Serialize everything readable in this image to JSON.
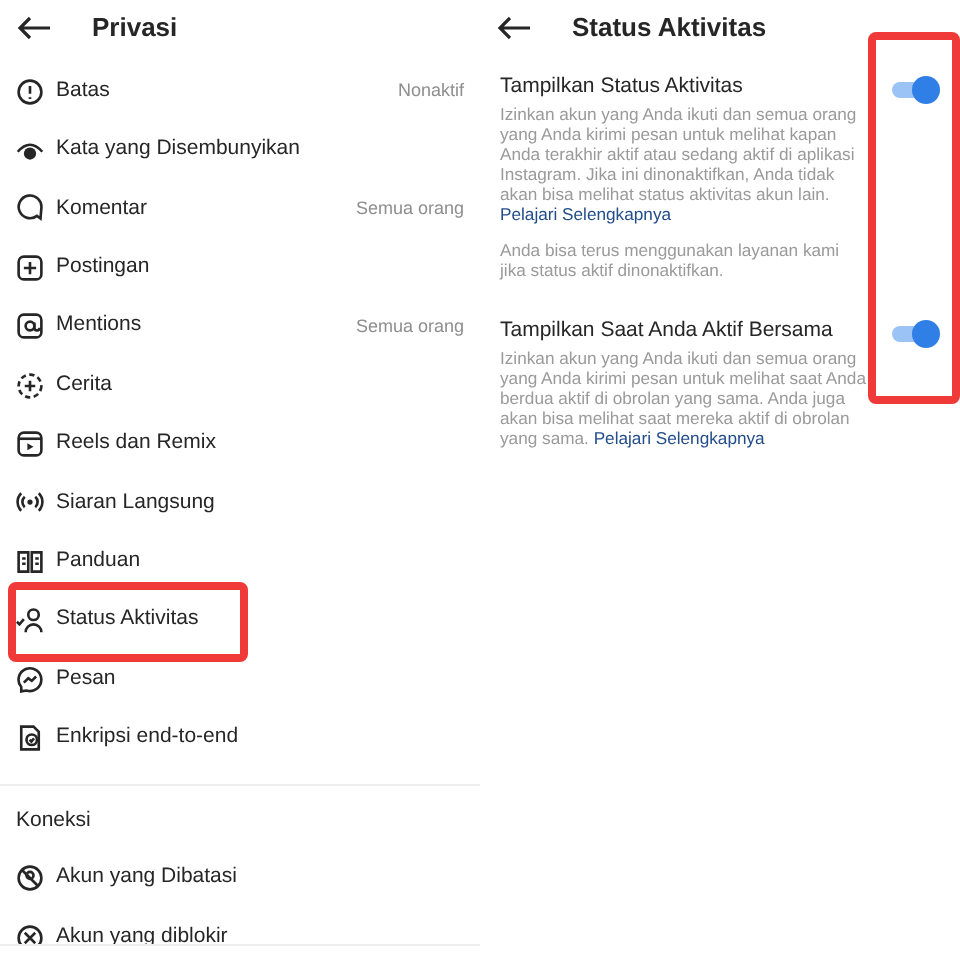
{
  "privacy_screen": {
    "title": "Privasi",
    "items": [
      {
        "kind": "limit",
        "label": "Batas",
        "value": "Nonaktif",
        "highlighted": false
      },
      {
        "kind": "eye",
        "label": "Kata yang Disembunyikan",
        "highlighted": false
      },
      {
        "kind": "comment",
        "label": "Komentar",
        "value": "Semua orang",
        "highlighted": false
      },
      {
        "kind": "plus",
        "label": "Postingan",
        "highlighted": false
      },
      {
        "kind": "at",
        "label": "Mentions",
        "value": "Semua orang",
        "highlighted": false
      },
      {
        "kind": "story",
        "label": "Cerita",
        "highlighted": false
      },
      {
        "kind": "reels",
        "label": "Reels dan Remix",
        "highlighted": false
      },
      {
        "kind": "live",
        "label": "Siaran Langsung",
        "highlighted": false
      },
      {
        "kind": "guide",
        "label": "Panduan",
        "highlighted": false
      },
      {
        "kind": "status",
        "label": "Status Aktivitas",
        "highlighted": true
      },
      {
        "kind": "messenger",
        "label": "Pesan",
        "highlighted": false
      },
      {
        "kind": "shield",
        "label": "Enkripsi end-to-end",
        "highlighted": false
      }
    ],
    "connections": {
      "heading": "Koneksi",
      "items": [
        {
          "kind": "restricted",
          "label": "Akun yang Dibatasi"
        },
        {
          "kind": "blocked",
          "label": "Akun yang diblokir"
        }
      ]
    }
  },
  "activity_screen": {
    "title": "Status Aktivitas",
    "toggles_highlighted": true,
    "settings": [
      {
        "title": "Tampilkan Status Aktivitas",
        "on": true,
        "description": "Izinkan akun yang Anda ikuti dan semua orang yang Anda kirimi pesan untuk melihat kapan Anda terakhir aktif atau sedang aktif di aplikasi Instagram. Jika ini dinonaktifkan, Anda tidak akan bisa melihat status aktivitas akun lain.",
        "link": "Pelajari Selengkapnya",
        "note": "Anda bisa terus menggunakan layanan kami jika status aktif dinonaktifkan."
      },
      {
        "title": "Tampilkan Saat Anda Aktif Bersama",
        "on": true,
        "description": "Izinkan akun yang Anda ikuti dan semua orang yang Anda kirimi pesan untuk melihat saat Anda berdua aktif di obrolan yang sama. Anda juga akan bisa melihat saat mereka aktif di obrolan yang sama.",
        "link": "Pelajari Selengkapnya"
      }
    ]
  }
}
